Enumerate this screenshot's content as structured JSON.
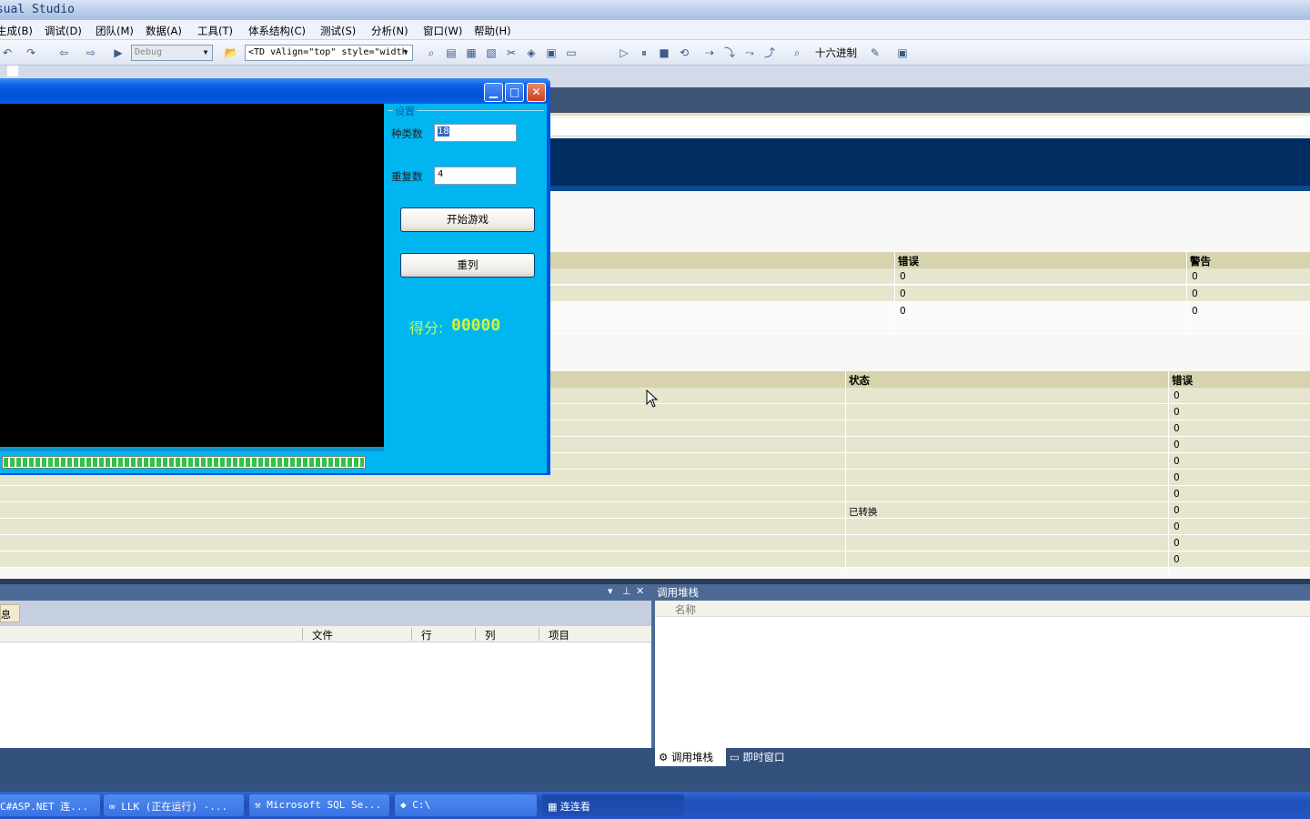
{
  "vs": {
    "title": "isual Studio",
    "menu": [
      "生成(B)",
      "调试(D)",
      "团队(M)",
      "数据(A)",
      "工具(T)",
      "体系结构(C)",
      "测试(S)",
      "分析(N)",
      "窗口(W)",
      "帮助(H)"
    ],
    "toolbar": {
      "config": "Debug",
      "find_combo": "<TD vAlign=\"top\" style=\"width",
      "hex_label": "十六进制"
    }
  },
  "build_table": {
    "headers": {
      "errors": "错误",
      "warnings": "警告"
    },
    "rows": [
      {
        "errors": "0",
        "warnings": "0"
      },
      {
        "errors": "0",
        "warnings": "0"
      },
      {
        "errors": "0",
        "warnings": "0"
      }
    ]
  },
  "status_table": {
    "headers": {
      "status": "状态",
      "errors": "错误"
    },
    "rows": [
      {
        "status": "",
        "errors": "0"
      },
      {
        "status": "",
        "errors": "0"
      },
      {
        "status": "",
        "errors": "0"
      },
      {
        "status": "",
        "errors": "0"
      },
      {
        "status": "",
        "errors": "0"
      },
      {
        "status": "",
        "errors": "0"
      },
      {
        "status": "",
        "errors": "0"
      },
      {
        "status": "已转换",
        "errors": "0"
      },
      {
        "status": "",
        "errors": "0"
      },
      {
        "status": "",
        "errors": "0"
      },
      {
        "status": "",
        "errors": "0"
      }
    ]
  },
  "error_list": {
    "tab": "息",
    "columns": {
      "file": "文件",
      "line": "行",
      "column": "列",
      "project": "项目"
    }
  },
  "call_stack": {
    "title": "调用堆栈",
    "column": "名称",
    "tabs": {
      "call_stack": "调用堆栈",
      "immediate": "即时窗口"
    }
  },
  "game": {
    "group_label": "设置",
    "kinds_label": "种类数",
    "kinds_value": "18",
    "repeat_label": "重复数",
    "repeat_value": "4",
    "start_button": "开始游戏",
    "shuffle_button": "重列",
    "score_label": "得分:",
    "score_value": "00000",
    "progress": 1.0
  },
  "taskbar": [
    "C#ASP.NET 连...",
    "LLK (正在运行) -...",
    "Microsoft SQL Se...",
    "C:\\",
    "连连看"
  ],
  "colors": {
    "game_bg": "#00b5f0",
    "score": "#cff53c",
    "taskbar": "#2457c4"
  }
}
